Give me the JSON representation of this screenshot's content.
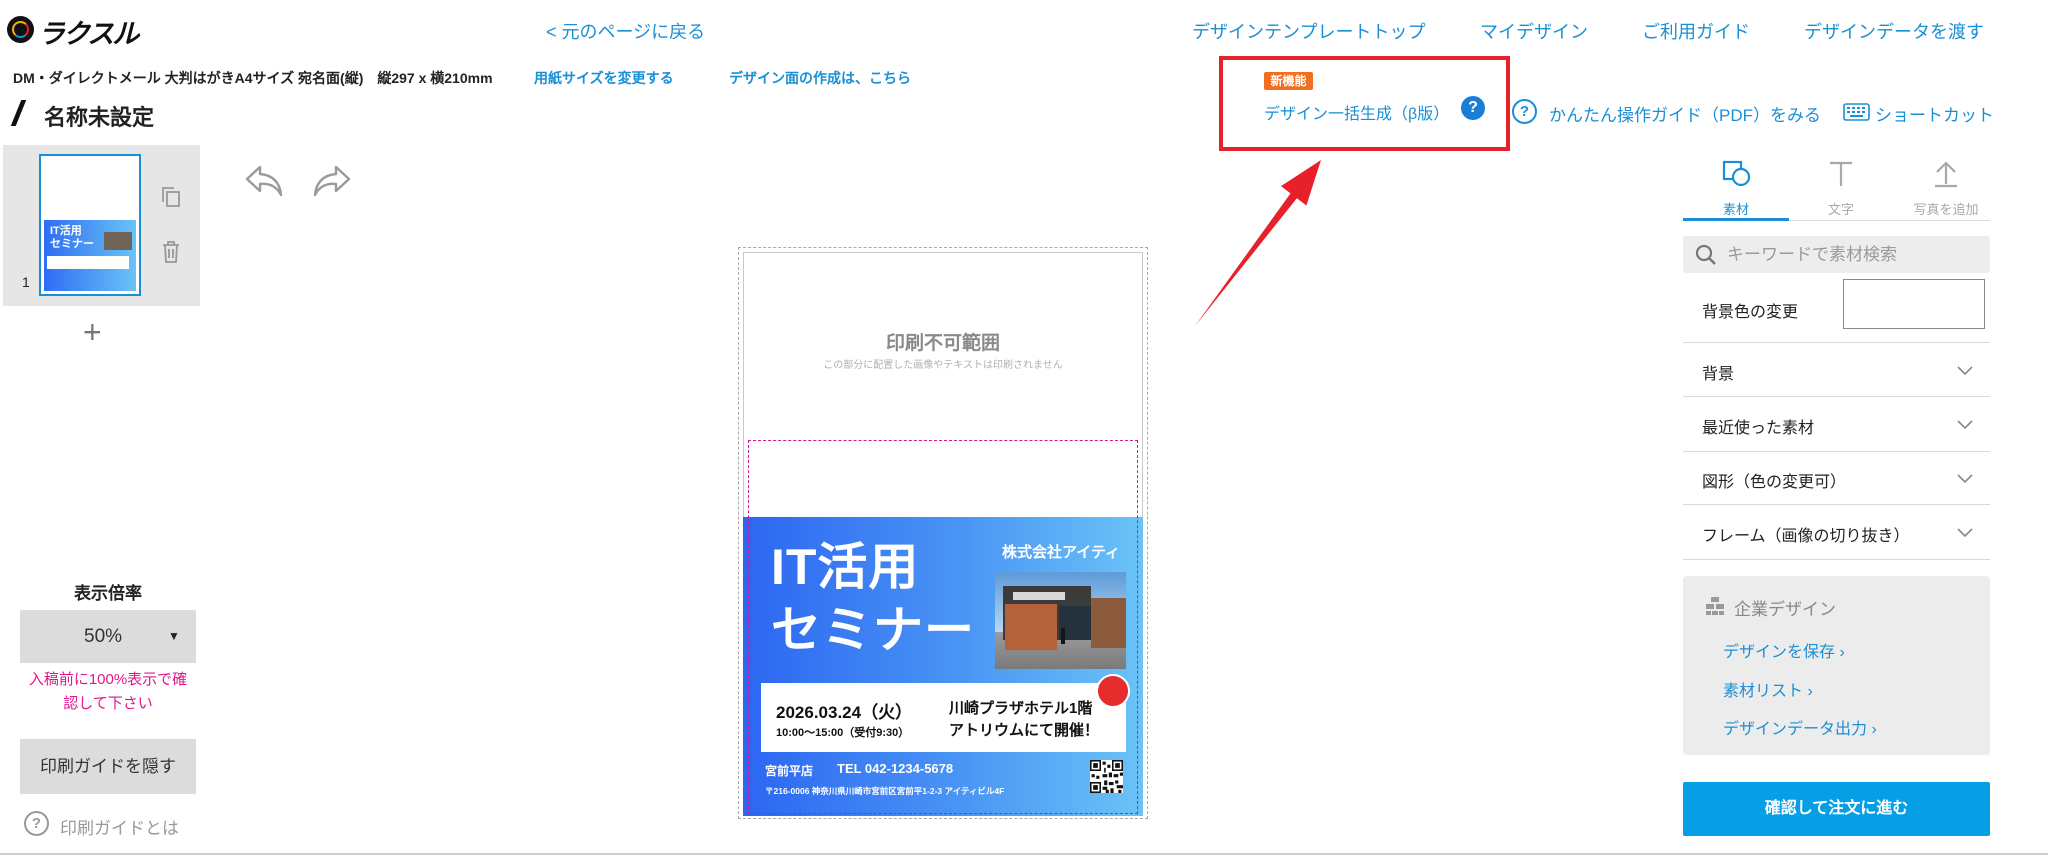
{
  "logo": {
    "text": "ラクスル",
    "icon": "raksul-logo-icon"
  },
  "header": {
    "back_link": "< 元のページに戻る",
    "nav": [
      {
        "label": "デザインテンプレートトップ"
      },
      {
        "label": "マイデザイン"
      },
      {
        "label": "ご利用ガイド"
      },
      {
        "label": "デザインデータを渡す"
      }
    ]
  },
  "product": {
    "description": "DM・ダイレクトメール 大判はがきA4サイズ 宛名面(縦)　縦297 x 横210mm",
    "change_size_link": "用紙サイズを変更する",
    "design_face_link": "デザイン面の作成は、こちら"
  },
  "document": {
    "title": "名称未設定",
    "icon": "pencil-icon"
  },
  "feature": {
    "badge": "新機能",
    "label": "デザイン一括生成（β版）",
    "help_icon": "question-circle-icon",
    "help_glyph": "?"
  },
  "help": {
    "guide_icon": "question-outline-icon",
    "guide_glyph": "?",
    "guide_link": "かんたん操作ガイド（PDF）をみる",
    "shortcut_icon": "keyboard-icon",
    "shortcut_label": "ショートカット"
  },
  "history": {
    "undo_icon": "undo-icon",
    "redo_icon": "redo-icon"
  },
  "pages": {
    "items": [
      {
        "number": "1"
      }
    ],
    "add_icon": "plus-icon",
    "add_glyph": "+",
    "copy_icon": "copy-icon",
    "delete_icon": "trash-icon"
  },
  "zoom": {
    "label": "表示倍率",
    "value": "50%",
    "caret": "▼",
    "note": "入稿前に100%表示で確認して下さい"
  },
  "print_guide": {
    "hide_button": "印刷ガイドを隠す",
    "help_glyph": "?",
    "help_link": "印刷ガイドとは"
  },
  "canvas": {
    "unprintable_title": "印刷不可範囲",
    "unprintable_note": "この部分に配置した画像やテキストは印刷されません"
  },
  "design": {
    "title_line1": "IT活用",
    "title_line2": "セミナー",
    "company": "株式会社アイティ",
    "date": "2026.03.24（火）",
    "time": "10:00～15:00（受付9:30）",
    "venue_line1": "川崎プラザホテル1階",
    "venue_line2": "アトリウムにて開催！",
    "store": "宮前平店",
    "tel": "TEL 042-1234-5678",
    "address": "〒216-0006 神奈川県川崎市宮前区宮前平1-2-3 アイティビル4F",
    "photo": "building-photo",
    "qr": "qr-code"
  },
  "sidebar": {
    "tabs": [
      {
        "label": "素材",
        "icon": "shapes-icon",
        "active": true
      },
      {
        "label": "文字",
        "icon": "text-icon",
        "active": false
      },
      {
        "label": "写真を追加",
        "icon": "upload-icon",
        "active": false
      }
    ],
    "search_placeholder": "キーワードで素材検索",
    "bg_color_label": "背景色の変更",
    "bg_color_value": "#ffffff",
    "sections": [
      {
        "label": "背景"
      },
      {
        "label": "最近使った素材"
      },
      {
        "label": "図形（色の変更可）"
      },
      {
        "label": "フレーム（画像の切り抜き）"
      }
    ],
    "company": {
      "icon": "building-icon",
      "title": "企業デザイン",
      "links": [
        {
          "label": "デザインを保存 ›"
        },
        {
          "label": "素材リスト ›"
        },
        {
          "label": "デザインデータ出力 ›"
        }
      ]
    },
    "order_button": "確認して注文に進む"
  },
  "colors": {
    "link": "#1a8fd6",
    "highlight_box": "#e8202a",
    "badge": "#f07020",
    "note": "#e3178c",
    "order_button": "#069fe6",
    "design_gradient_start": "#2c66f2",
    "design_gradient_end": "#6ac3f7"
  }
}
